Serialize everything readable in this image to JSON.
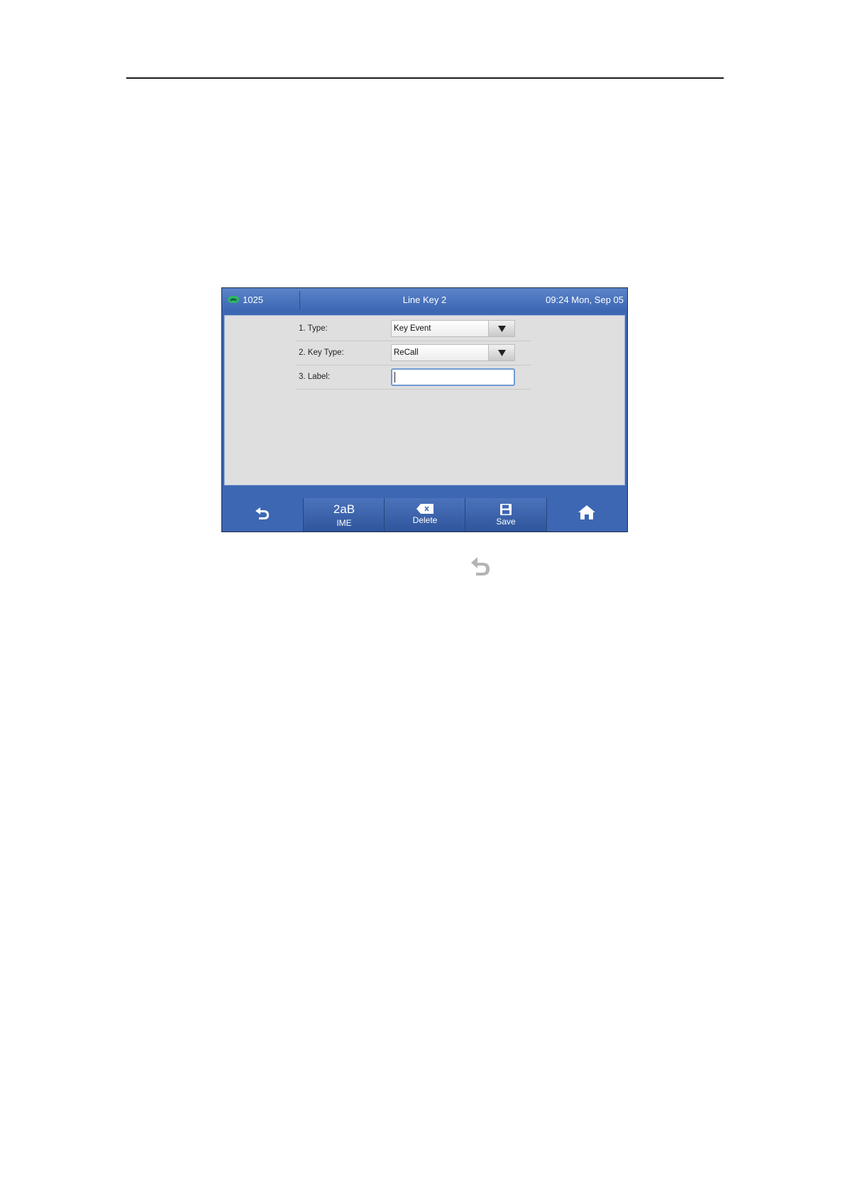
{
  "screen": {
    "account": "1025",
    "title": "Line Key 2",
    "clock": "09:24 Mon, Sep 05"
  },
  "form": {
    "rows": [
      {
        "label": "1. Type:",
        "value": "Key Event"
      },
      {
        "label": "2. Key Type:",
        "value": "ReCall"
      },
      {
        "label": "3. Label:",
        "value": ""
      }
    ]
  },
  "softkeys": {
    "ime_top": "2aB",
    "ime_label": "IME",
    "delete_label": "Delete",
    "save_label": "Save"
  },
  "icons": {
    "account": "phone-icon",
    "back": "back-arrow-icon",
    "delete": "backspace-icon",
    "save": "floppy-disk-icon",
    "home": "home-icon",
    "dropdown": "triangle-down-icon"
  },
  "colors": {
    "screen_blue": "#3d67b3",
    "panel_gray": "#dfdfdf",
    "focus_border": "#6f9bd4",
    "phone_green": "#2fb36b"
  }
}
